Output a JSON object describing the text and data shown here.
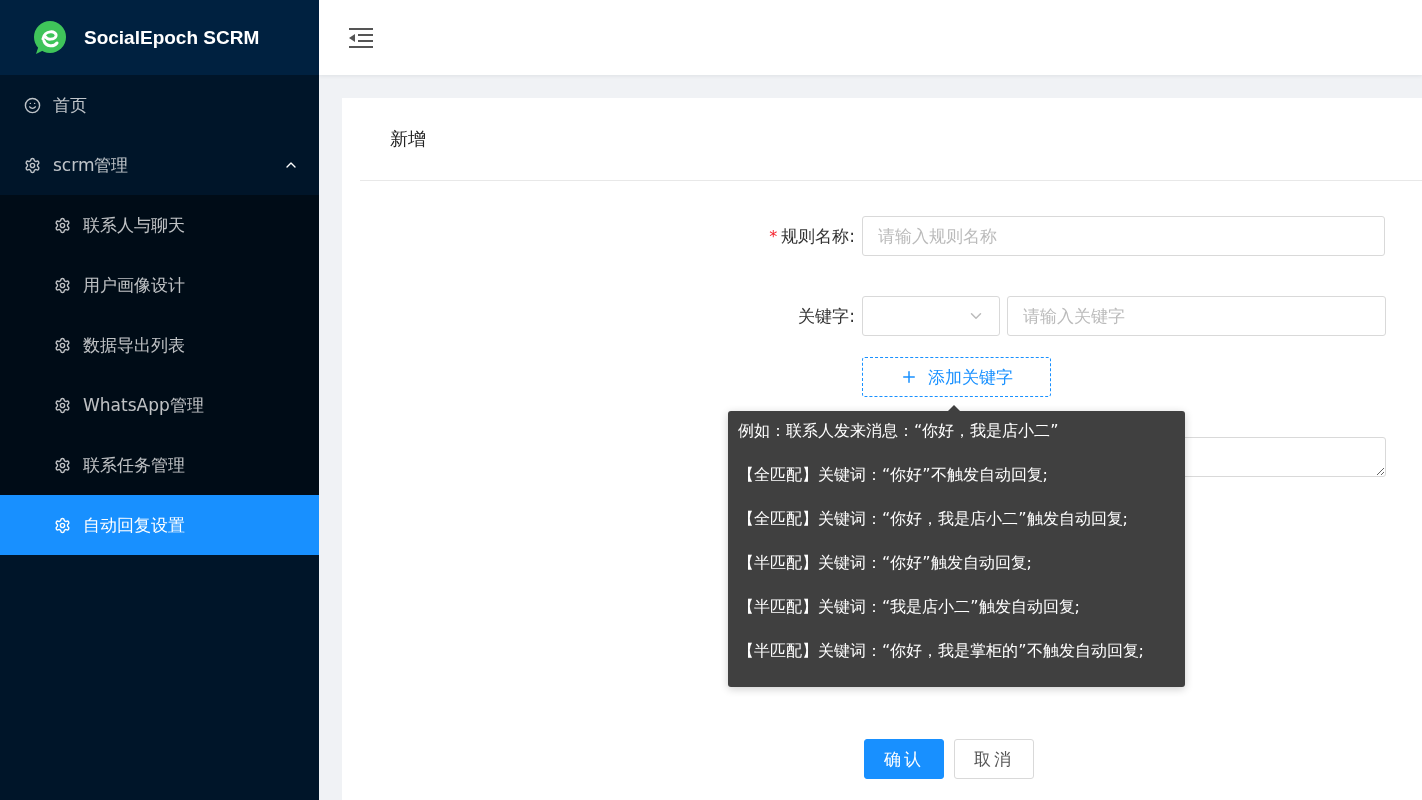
{
  "brand": {
    "name": "SocialEpoch SCRM"
  },
  "sidebar": {
    "items": [
      {
        "label": "首页",
        "selected": false
      },
      {
        "label": "scrm管理",
        "selected": false,
        "expanded": true,
        "children": [
          {
            "label": "联系人与聊天",
            "selected": false
          },
          {
            "label": "用户画像设计",
            "selected": false
          },
          {
            "label": "数据导出列表",
            "selected": false
          },
          {
            "label": "WhatsApp管理",
            "selected": false
          },
          {
            "label": "联系任务管理",
            "selected": false
          },
          {
            "label": "自动回复设置",
            "selected": true
          }
        ]
      }
    ]
  },
  "card": {
    "title": "新增"
  },
  "form": {
    "rule_name": {
      "label": "规则名称:",
      "required_mark": "*",
      "placeholder": "请输入规则名称"
    },
    "keyword": {
      "label": "关键字:",
      "placeholder": "请输入关键字"
    },
    "add_keyword": {
      "label": "添加关键字"
    }
  },
  "tooltip": {
    "lines": [
      "例如：联系人发来消息：“你好，我是店小二”",
      "【全匹配】关键词：“你好”不触发自动回复;",
      "【全匹配】关键词：“你好，我是店小二”触发自动回复;",
      "【半匹配】关键词：“你好”触发自动回复;",
      "【半匹配】关键词：“我是店小二”触发自动回复;",
      "【半匹配】关键词：“你好，我是掌柜的”不触发自动回复;"
    ]
  },
  "buttons": [
    {
      "label": "确认",
      "kind": "primary"
    },
    {
      "label": "取消",
      "kind": "default"
    }
  ]
}
